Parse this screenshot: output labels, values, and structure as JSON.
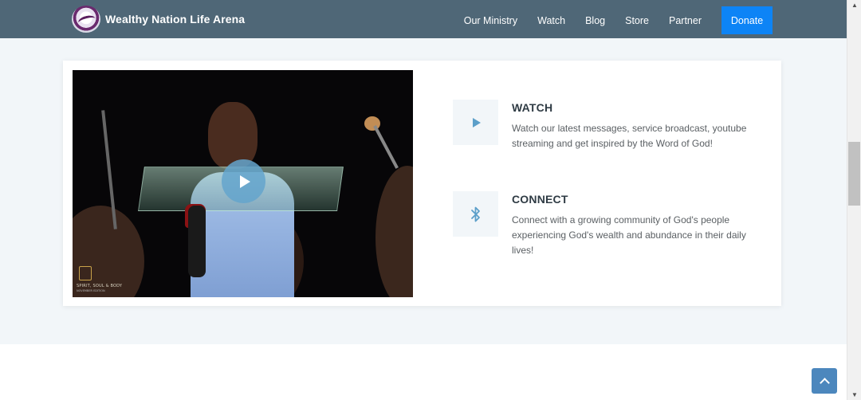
{
  "header": {
    "brand_name": "Wealthy Nation Life Arena",
    "nav": [
      "Our Ministry",
      "Watch",
      "Blog",
      "Store",
      "Partner"
    ],
    "donate_label": "Donate"
  },
  "video": {
    "watermark_title": "SPIRIT, SOUL & BODY",
    "watermark_sub": "NOVEMBER EDITION"
  },
  "features": [
    {
      "icon": "play-icon",
      "title": "WATCH",
      "description": "Watch our latest messages, service broadcast, youtube streaming and get inspired by the Word of God!"
    },
    {
      "icon": "bluetooth-icon",
      "title": "CONNECT",
      "description": "Connect with a growing community of God's people experiencing God's wealth and abundance in their daily lives!"
    }
  ],
  "colors": {
    "header_bg": "#4f6777",
    "donate_bg": "#0d84f6",
    "section_bg": "#f2f6f9",
    "icon_accent": "#5c9fc9",
    "back_to_top_bg": "#4c87bd"
  }
}
